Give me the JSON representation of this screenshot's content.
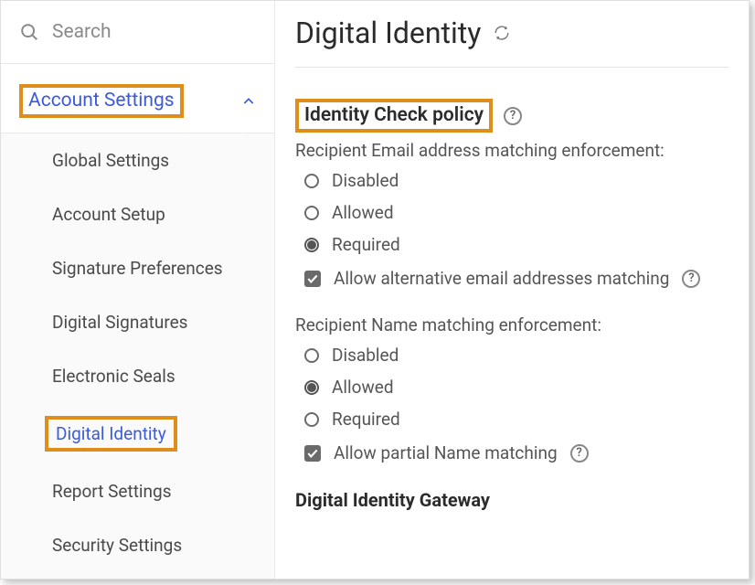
{
  "sidebar": {
    "search_placeholder": "Search",
    "section_label": "Account Settings",
    "items": [
      {
        "label": "Global Settings",
        "selected": false
      },
      {
        "label": "Account Setup",
        "selected": false
      },
      {
        "label": "Signature Preferences",
        "selected": false
      },
      {
        "label": "Digital Signatures",
        "selected": false
      },
      {
        "label": "Electronic Seals",
        "selected": false
      },
      {
        "label": "Digital Identity",
        "selected": true
      },
      {
        "label": "Report Settings",
        "selected": false
      },
      {
        "label": "Security Settings",
        "selected": false
      }
    ]
  },
  "main": {
    "title": "Digital Identity",
    "section_title": "Identity Check policy",
    "email_group": {
      "label": "Recipient Email address matching enforcement:",
      "options": [
        {
          "label": "Disabled",
          "checked": false
        },
        {
          "label": "Allowed",
          "checked": false
        },
        {
          "label": "Required",
          "checked": true
        }
      ],
      "checkbox": {
        "label": "Allow alternative email addresses matching",
        "checked": true
      }
    },
    "name_group": {
      "label": "Recipient Name matching enforcement:",
      "options": [
        {
          "label": "Disabled",
          "checked": false
        },
        {
          "label": "Allowed",
          "checked": true
        },
        {
          "label": "Required",
          "checked": false
        }
      ],
      "checkbox": {
        "label": "Allow partial Name matching",
        "checked": true
      }
    },
    "gateway_title": "Digital Identity Gateway"
  }
}
